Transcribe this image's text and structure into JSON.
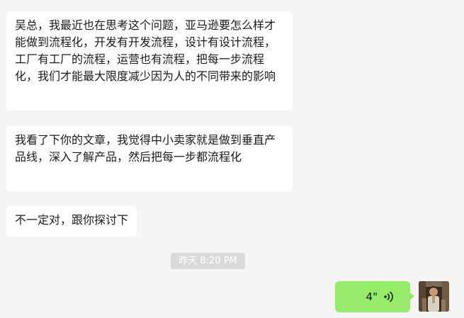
{
  "chat": {
    "messages": [
      {
        "side": "left",
        "text": "吴总，我最近也在思考这个问题，亚马逊要怎么样才能做到流程化，开发有开发流程，设计有设计流程，工厂有工厂的流程，运营也有流程，把每一步流程化，我们才能最大限度减少因为人的不同带来的影响"
      },
      {
        "side": "left",
        "text": "我看了下你的文章，我觉得中小卖家就是做到垂直产品线，深入了解产品，然后把每一步都流程化"
      },
      {
        "side": "left",
        "text": "不一定对，跟你探讨下"
      }
    ],
    "timestamp": "昨天 8:20 PM",
    "voice_message": {
      "side": "right",
      "duration": "4\"",
      "icon": "voice-wave-icon"
    },
    "avatar": {
      "icon": "user-avatar-photo"
    }
  },
  "colors": {
    "background": "#f5f5f5",
    "incoming_bubble": "#ffffff",
    "outgoing_bubble": "#95ec69",
    "timestamp_bg": "#dadada"
  }
}
